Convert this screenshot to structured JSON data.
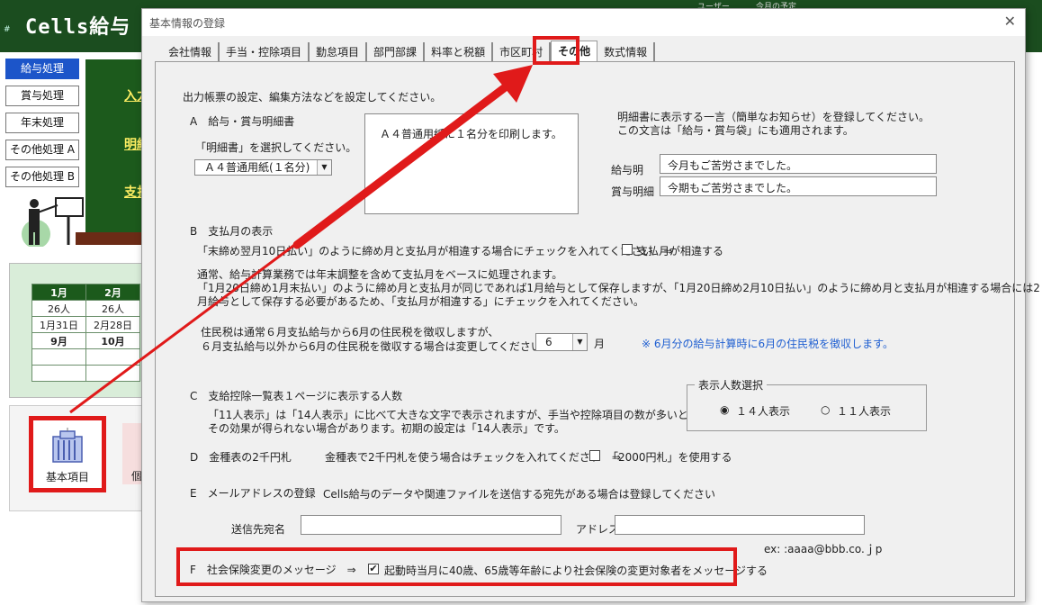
{
  "app": {
    "hash": "#",
    "title": "Cells給与",
    "top_small_1": "ユーザー",
    "top_small_2": "今月の予定"
  },
  "left_menu": [
    {
      "label": "給与処理",
      "active": true
    },
    {
      "label": "賞与処理",
      "active": false
    },
    {
      "label": "年末処理",
      "active": false
    },
    {
      "label": "その他処理 A",
      "active": false
    },
    {
      "label": "その他処理 B",
      "active": false
    }
  ],
  "board": {
    "link1": "入力",
    "link2": "明細",
    "link3": "支払"
  },
  "calendar": {
    "headers": [
      "1月",
      "2月"
    ],
    "rows": [
      [
        "26人",
        "26人"
      ],
      [
        "1月31日",
        "2月28日"
      ],
      [
        "9月",
        "10月"
      ],
      [
        "",
        ""
      ],
      [
        "",
        ""
      ]
    ]
  },
  "tools": {
    "kihon_label": "基本項目",
    "second_label": "個"
  },
  "dialog": {
    "title": "基本情報の登録",
    "close": "✕",
    "tabs": [
      "会社情報",
      "手当・控除項目",
      "勤怠項目",
      "部門部課",
      "料率と税額",
      "市区町村",
      "その他",
      "数式情報"
    ],
    "selected_tab": "その他",
    "intro": "出力帳票の設定、編集方法などを設定してください。",
    "sectionA": {
      "heading": "A　給与・賞与明細書",
      "prompt": "「明細書」を選択してください。",
      "select_value": "Ａ４普通用紙(１名分)",
      "preview_text": "Ａ４普通用紙に１名分を印刷します。",
      "msg_note1": "明細書に表示する一言（簡単なお知らせ）を登録してください。",
      "msg_note2": "この文言は「給与・賞与袋」にも適用されます。",
      "kyuyo_label": "給与明",
      "kyuyo_value": "今月もご苦労さまでした。",
      "shoyo_label": "賞与明細",
      "shoyo_value": "今期もご苦労さまでした。"
    },
    "sectionB": {
      "heading": "B　支払月の表示",
      "line1": "「末締め翌月10日払い」のように締め月と支払月が相違する場合にチェックを入れてください　⇒",
      "checkbox_label": "支払月が相違する",
      "para1": "通常、給与計算業務では年末調整を含めて支払月をベースに処理されます。",
      "para2": "「1月20日締め1月末払い」のように締め月と支払月が同じであれば1月給与として保存しますが、「1月20日締め2月10日払い」のように締め月と支払月が相違する場合には2",
      "para3": "月給与として保存する必要があるため、「支払月が相違する」にチェックを入れてください。",
      "jumin1": "住民税は通常６月支払給与から6月の住民税を徴収しますが、",
      "jumin2": "６月支払給与以外から6月の住民税を徴収する場合は変更してください　⇒",
      "month_value": "6",
      "month_unit": "月",
      "note_blue": "※ 6月分の給与計算時に6月の住民税を徴収します。"
    },
    "sectionC": {
      "heading": "C　支給控除一覧表１ページに表示する人数",
      "desc1": "「11人表示」は「14人表示」に比べて大きな文字で表示されますが、手当や控除項目の数が多いと",
      "desc2": "その効果が得られない場合があります。初期の設定は「14人表示」です。",
      "group_label": "表示人数選択",
      "opt1": "１４人表示",
      "opt2": "１１人表示"
    },
    "sectionD": {
      "heading": "D　金種表の2千円札",
      "desc": "金種表で2千円札を使う場合はチェックを入れてください　⇒",
      "checkbox_label": "「2000円札」を使用する"
    },
    "sectionE": {
      "heading": "E　メールアドレスの登録",
      "desc": "Cells給与のデータや関連ファイルを送信する宛先がある場合は登録してください",
      "name_label": "送信先宛名",
      "name_value": "",
      "addr_label": "アドレス",
      "addr_value": "",
      "example": "ex: :aaaa@bbb.co.ｊp"
    },
    "sectionF": {
      "heading": "F　社会保険変更のメッセージ　⇒",
      "checkbox_label": "起動時当月に40歳、65歳等年齢により社会保険の変更対象者をメッセージする",
      "checked": true
    }
  },
  "colors": {
    "highlight": "#e01a1a",
    "header_green": "#1b4d1f",
    "accent_blue": "#1c55c9"
  }
}
